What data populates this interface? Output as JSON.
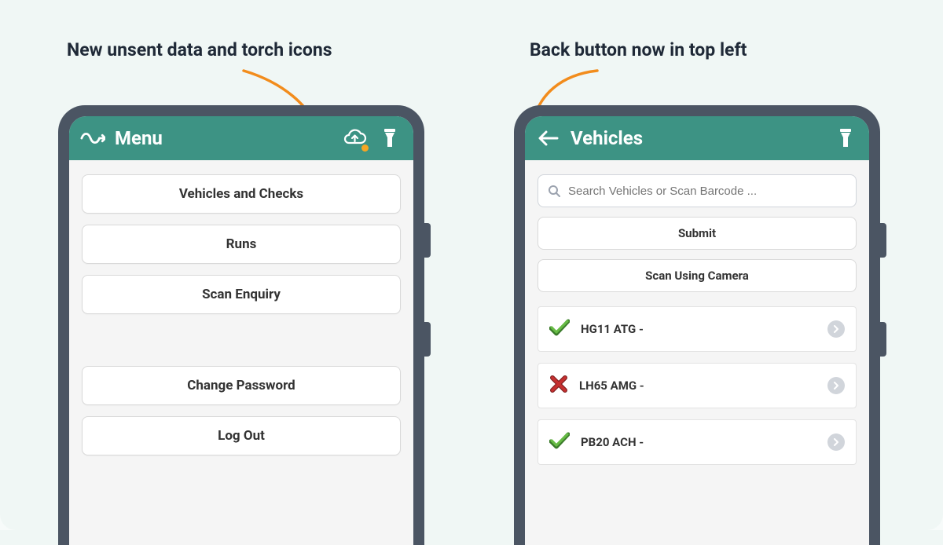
{
  "annotations": {
    "left": "New unsent data and torch icons",
    "right": "Back button now in top left"
  },
  "left_phone": {
    "title": "Menu",
    "menu": {
      "vehicles": "Vehicles and Checks",
      "runs": "Runs",
      "scan": "Scan Enquiry",
      "change_pw": "Change Password",
      "logout": "Log Out"
    }
  },
  "right_phone": {
    "title": "Vehicles",
    "search_placeholder": "Search Vehicles or Scan Barcode ...",
    "submit": "Submit",
    "scan_camera": "Scan Using Camera",
    "items": [
      {
        "label": "HG11 ATG -",
        "status": "ok"
      },
      {
        "label": "LH65 AMG -",
        "status": "fail"
      },
      {
        "label": "PB20 ACH -",
        "status": "ok"
      }
    ]
  },
  "colors": {
    "accent": "#3d9384",
    "frame": "#4b5563",
    "arrow": "#f28c1c",
    "ok": "#4caf50",
    "fail": "#c53030"
  }
}
